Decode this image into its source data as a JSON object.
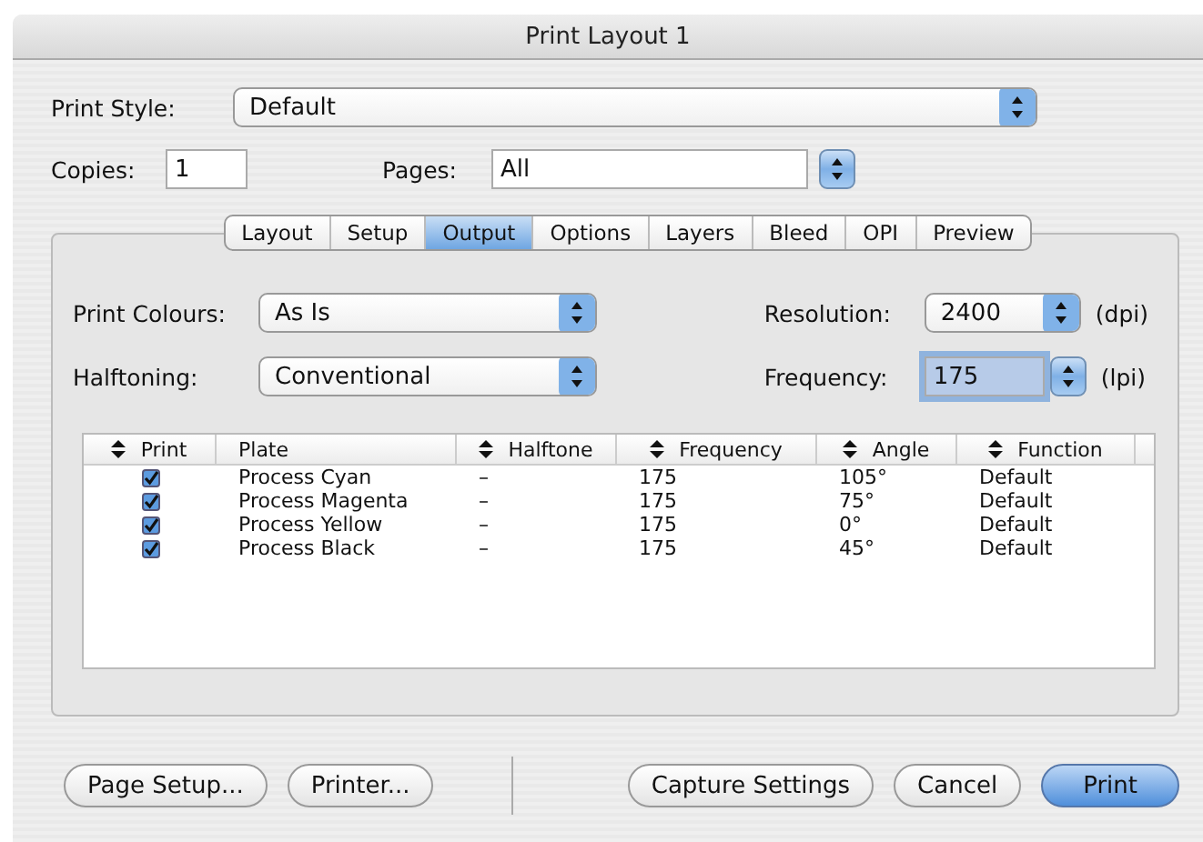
{
  "window": {
    "title": "Print Layout 1"
  },
  "print_style": {
    "label": "Print Style:",
    "value": "Default"
  },
  "copies": {
    "label": "Copies:",
    "value": "1"
  },
  "pages": {
    "label": "Pages:",
    "value": "All"
  },
  "tabs": [
    {
      "label": "Layout",
      "selected": false
    },
    {
      "label": "Setup",
      "selected": false
    },
    {
      "label": "Output",
      "selected": true
    },
    {
      "label": "Options",
      "selected": false
    },
    {
      "label": "Layers",
      "selected": false
    },
    {
      "label": "Bleed",
      "selected": false
    },
    {
      "label": "OPI",
      "selected": false
    },
    {
      "label": "Preview",
      "selected": false
    }
  ],
  "print_colours": {
    "label": "Print Colours:",
    "value": "As Is"
  },
  "halftoning": {
    "label": "Halftoning:",
    "value": "Conventional"
  },
  "resolution": {
    "label": "Resolution:",
    "value": "2400",
    "unit": "(dpi)"
  },
  "frequency": {
    "label": "Frequency:",
    "value": "175",
    "unit": "(lpi)",
    "focused": true
  },
  "table": {
    "columns": [
      {
        "label": "Print",
        "sortable": true
      },
      {
        "label": "Plate",
        "sortable": false
      },
      {
        "label": "Halftone",
        "sortable": true
      },
      {
        "label": "Frequency",
        "sortable": true
      },
      {
        "label": "Angle",
        "sortable": true
      },
      {
        "label": "Function",
        "sortable": true
      }
    ],
    "rows": [
      {
        "checked": true,
        "plate": "Process Cyan",
        "halftone": "–",
        "frequency": "175",
        "angle": "105°",
        "function": "Default"
      },
      {
        "checked": true,
        "plate": "Process Magenta",
        "halftone": "–",
        "frequency": "175",
        "angle": "75°",
        "function": "Default"
      },
      {
        "checked": true,
        "plate": "Process Yellow",
        "halftone": "–",
        "frequency": "175",
        "angle": "0°",
        "function": "Default"
      },
      {
        "checked": true,
        "plate": "Process Black",
        "halftone": "–",
        "frequency": "175",
        "angle": "45°",
        "function": "Default"
      }
    ]
  },
  "left_buttons": [
    {
      "label": "Page Setup...",
      "default": false
    },
    {
      "label": "Printer...",
      "default": false
    }
  ],
  "right_buttons": [
    {
      "label": "Capture Settings",
      "default": false
    },
    {
      "label": "Cancel",
      "default": false
    },
    {
      "label": "Print",
      "default": true
    }
  ]
}
